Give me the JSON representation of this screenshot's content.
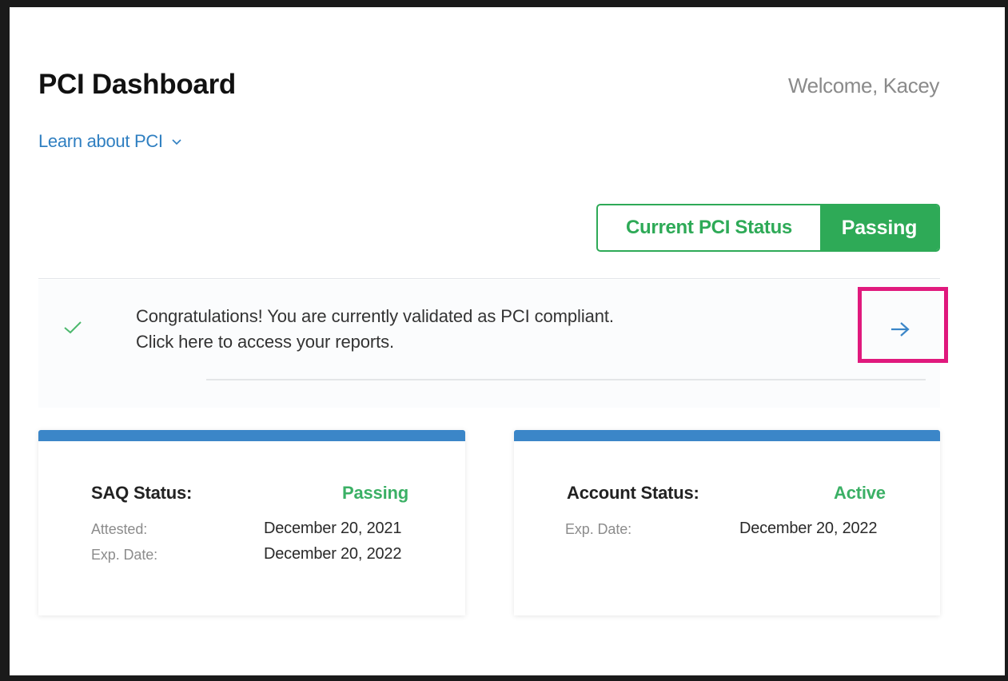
{
  "header": {
    "title": "PCI Dashboard",
    "welcome": "Welcome, Kacey"
  },
  "learn_link": {
    "label": "Learn about PCI",
    "icon": "chevron-down-icon"
  },
  "status": {
    "label": "Current PCI Status",
    "value": "Passing",
    "color": "#2eaa57"
  },
  "banner": {
    "line1": "Congratulations! You are currently validated as PCI compliant.",
    "line2": "Click here to access your reports.",
    "check_icon": "check-icon",
    "arrow_icon": "arrow-right-icon",
    "highlight_color": "#e0197d"
  },
  "saq_card": {
    "title": "SAQ Status:",
    "status": "Passing",
    "rows": [
      {
        "label": "Attested:",
        "value": "December 20, 2021"
      },
      {
        "label": "Exp. Date:",
        "value": "December 20, 2022"
      }
    ]
  },
  "account_card": {
    "title": "Account Status:",
    "status": "Active",
    "rows": [
      {
        "label": "Exp. Date:",
        "value": "December 20, 2022"
      }
    ]
  },
  "colors": {
    "accent_blue": "#3b86c8",
    "link_blue": "#2f7fc1",
    "success_green": "#2eaa57"
  }
}
